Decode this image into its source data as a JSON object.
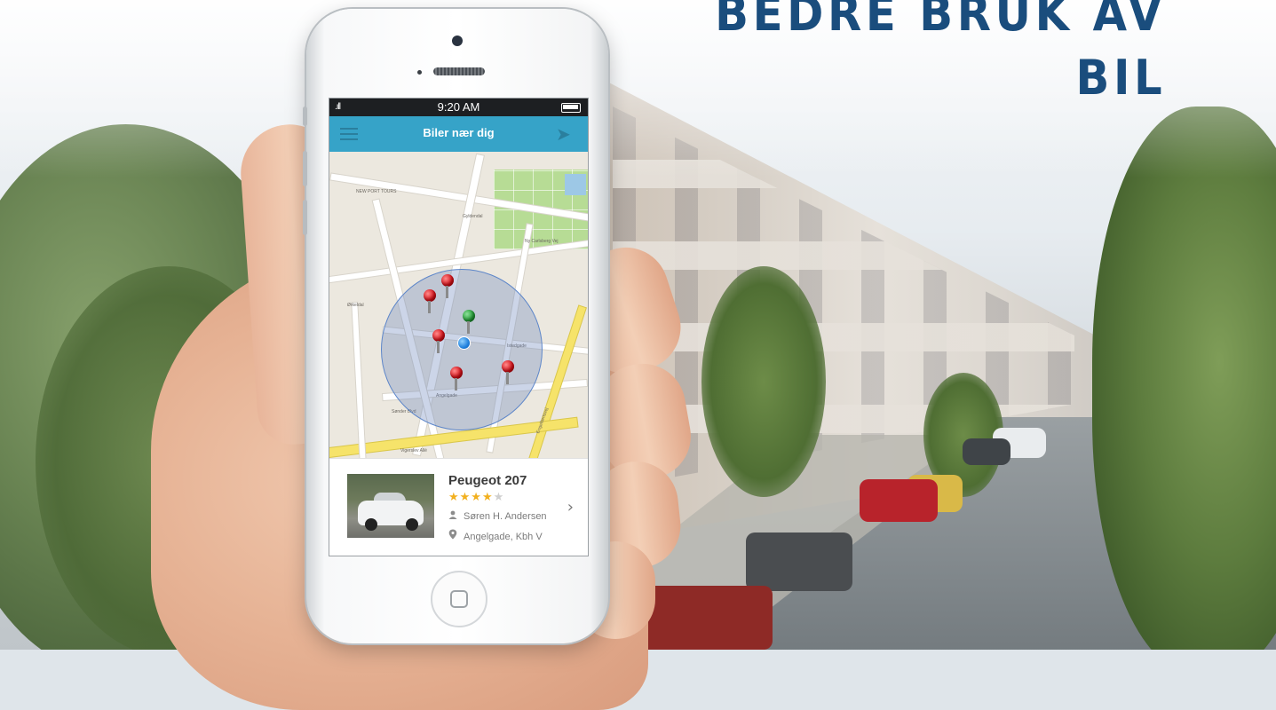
{
  "headline": {
    "line1": "BEDRE BRUK AV",
    "line2": "BIL"
  },
  "colors": {
    "headline": "#1a4d7d",
    "navbar": "#36a3c8",
    "star": "#f2b01e"
  },
  "phone": {
    "status_bar": {
      "signal": ".ıll",
      "time": "9:20 AM"
    },
    "nav": {
      "title": "Biler nær dig",
      "menu_icon": "hamburger-menu-icon",
      "send_icon": "paper-plane-icon",
      "send_glyph": "➤"
    },
    "map": {
      "pins": [
        {
          "color": "red"
        },
        {
          "color": "red"
        },
        {
          "color": "green"
        },
        {
          "color": "red"
        },
        {
          "color": "red"
        },
        {
          "color": "red"
        }
      ],
      "labels": [
        "NEW PORT TOURS",
        "Gyldendal",
        "Ny Carlsberg Vej",
        "Ørkeldal",
        "Istedgade",
        "Angelgade",
        "Sønder Blvd",
        "Vigerslev Allé",
        "Engelbertsvej"
      ]
    },
    "car_card": {
      "name": "Peugeot 207",
      "rating": 4,
      "rating_max": 5,
      "stars_on": "★★★★",
      "stars_off": "★",
      "owner": "Søren H. Andersen",
      "location": "Angelgade, Kbh V",
      "owner_icon": "user-icon",
      "location_icon": "map-marker-icon",
      "chevron": "›"
    }
  }
}
